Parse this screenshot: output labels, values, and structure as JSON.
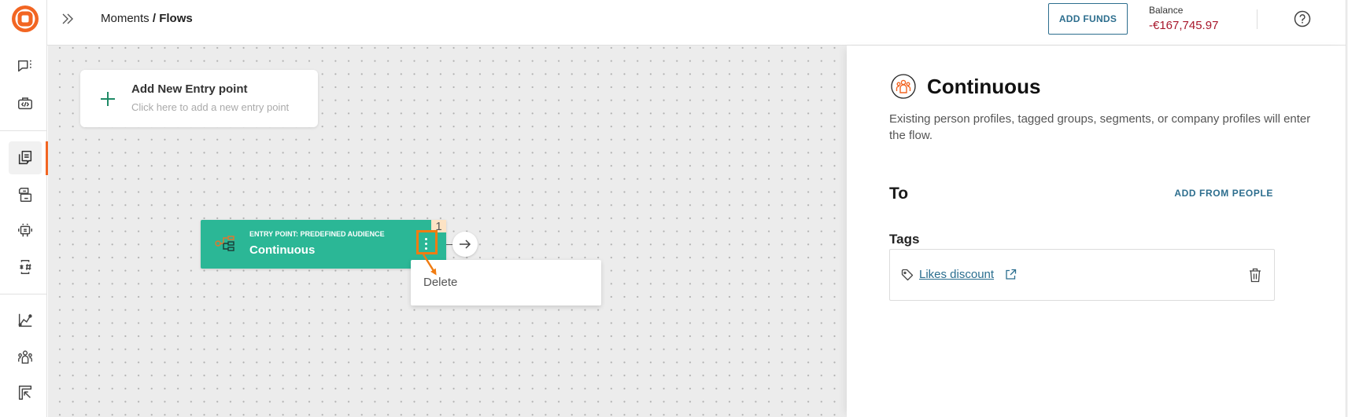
{
  "app": {
    "logo_icon": "brand-logo-icon"
  },
  "sidebar": {
    "items": [
      {
        "icon": "chat-bubble-icon",
        "active": false
      },
      {
        "icon": "code-briefcase-icon",
        "active": false
      },
      {
        "icon": "copy-documents-icon",
        "active": true
      },
      {
        "icon": "stacked-cards-icon",
        "active": false
      },
      {
        "icon": "robot-icon",
        "active": false
      },
      {
        "icon": "asterisk-hash-icon",
        "active": false
      },
      {
        "icon": "line-chart-icon",
        "active": false
      },
      {
        "icon": "people-icon",
        "active": false
      },
      {
        "icon": "board-arrow-icon",
        "active": false
      }
    ]
  },
  "header": {
    "expand_icon": "double-chevron-right-icon",
    "breadcrumb": {
      "parent": "Moments",
      "separator": " / ",
      "current": "Flows"
    },
    "add_funds_label": "ADD FUNDS",
    "balance_label": "Balance",
    "balance_value": "-€167,745.97",
    "help_icon": "help-icon"
  },
  "canvas": {
    "add_entry": {
      "title": "Add New Entry point",
      "subtitle": "Click here to add a new entry point"
    },
    "node": {
      "type_label": "ENTRY POINT: PREDEFINED AUDIENCE",
      "name": "Continuous",
      "badge": "1"
    },
    "context_menu": {
      "items": [
        "Delete"
      ]
    }
  },
  "panel": {
    "title": "Continuous",
    "description": "Existing person profiles, tagged groups, segments, or company profiles will enter the flow.",
    "to_label": "To",
    "add_from_people_label": "ADD FROM PEOPLE",
    "tags_label": "Tags",
    "tags": [
      {
        "label": "Likes discount"
      }
    ]
  },
  "colors": {
    "brand_accent": "#f26522",
    "node_green": "#2bb796",
    "link_blue": "#2d6e8e",
    "balance_negative": "#a8172b",
    "annotation_orange": "#f07c12",
    "badge_peach": "#fde3c4"
  }
}
